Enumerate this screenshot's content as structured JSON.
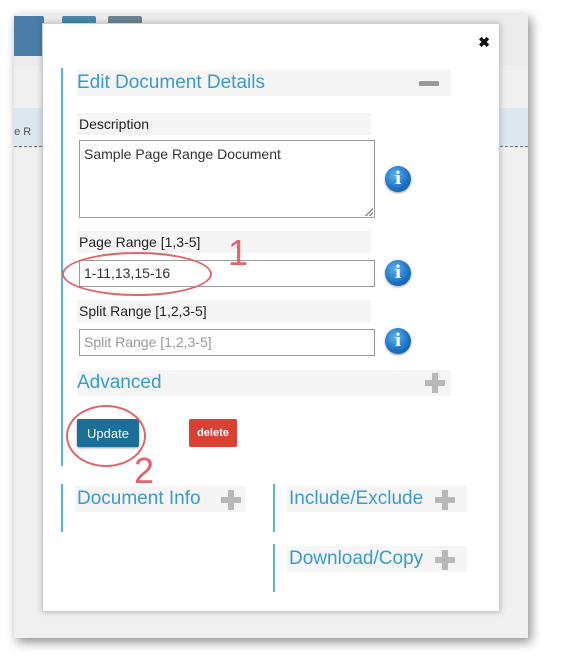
{
  "background": {
    "strip_text": "ge R"
  },
  "modal": {
    "close_symbol": "✖",
    "section_title": "Edit Document Details",
    "description": {
      "label": "Description",
      "value": "Sample Page Range Document"
    },
    "page_range": {
      "label": "Page Range [1,3-5]",
      "value": "1-11,13,15-16"
    },
    "split_range": {
      "label": "Split Range [1,2,3-5]",
      "placeholder": "Split Range [1,2,3-5]"
    },
    "info_symbol": "i",
    "advanced_title": "Advanced",
    "update_label": "Update",
    "delete_label": "delete",
    "cards": {
      "document_info": "Document Info",
      "include_exclude": "Include/Exclude",
      "download_copy": "Download/Copy"
    }
  },
  "annotations": {
    "one": "1",
    "two": "2",
    "color": "#e0646a"
  }
}
